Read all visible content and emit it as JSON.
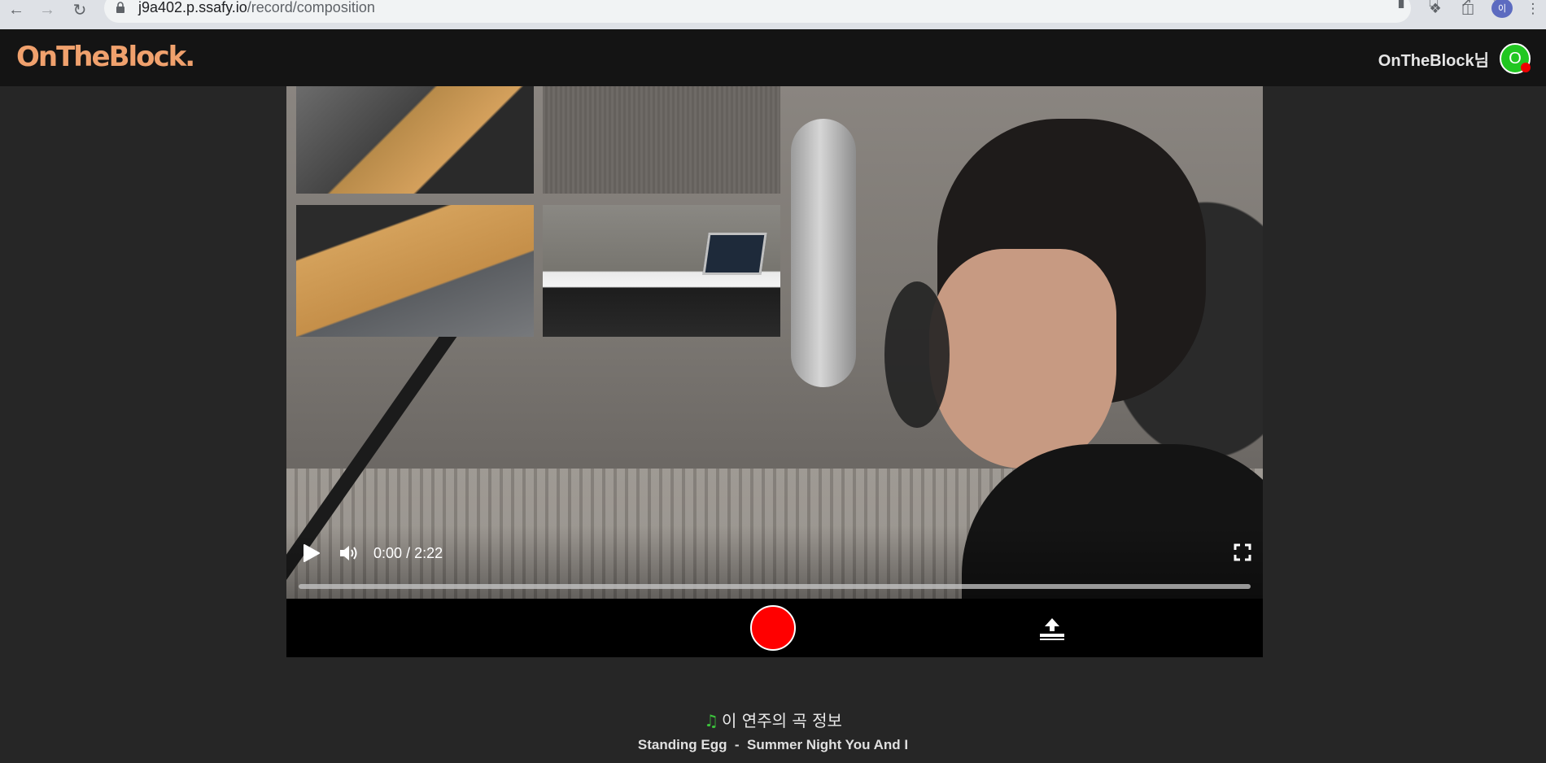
{
  "browser": {
    "url_host": "j9a402.p.ssafy.io",
    "url_path": "/record/composition",
    "profile_initial": "이",
    "icons": [
      "back-icon",
      "forward-icon",
      "reload-icon",
      "lock-icon",
      "camera-icon",
      "translate-icon",
      "share-icon",
      "bookmark-star-icon",
      "extensions-icon",
      "side-panel-icon",
      "menu-icon"
    ]
  },
  "header": {
    "logo": "OnTheBlock.",
    "user_name": "OnTheBlock님",
    "avatar_initial": "O",
    "avatar_color": "#21c721",
    "status_dot_color": "#ee0000",
    "logo_color": "#f0a16d"
  },
  "player": {
    "current_time": "0:00",
    "separator": "/",
    "duration": "2:22",
    "progress": 0.0,
    "icons": [
      "play-icon",
      "volume-icon",
      "fullscreen-icon"
    ]
  },
  "record_bar": {
    "record_color": "#ff0000",
    "icons": [
      "record-icon",
      "upload-icon"
    ]
  },
  "song_info": {
    "heading": "이 연주의 곡 정보",
    "artist": "Standing Egg",
    "separator": "-",
    "title": "Summer Night You And I",
    "icon": "music-note-icon"
  }
}
